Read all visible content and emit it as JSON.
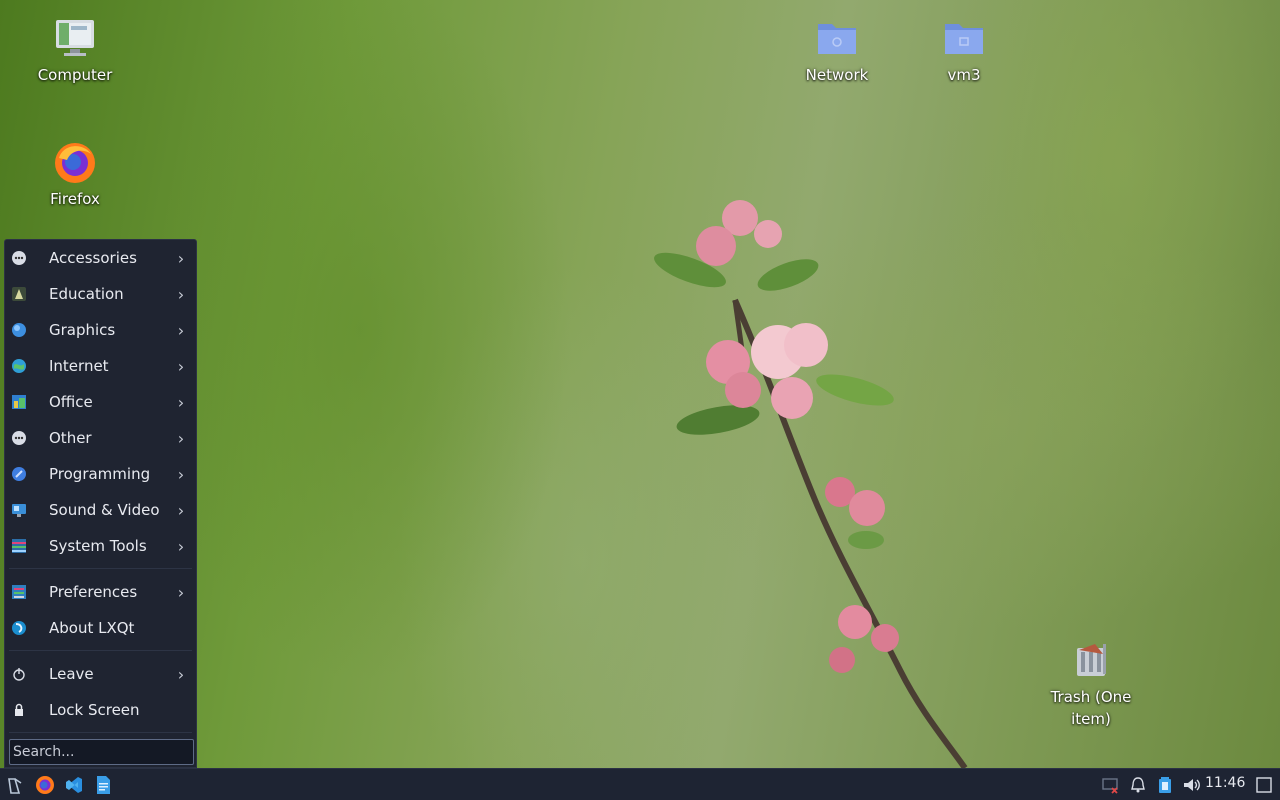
{
  "desktop": {
    "icons": [
      {
        "label": "Computer",
        "icon": "computer-icon"
      },
      {
        "label": "Firefox",
        "icon": "firefox-icon"
      },
      {
        "label": "Network",
        "icon": "network-folder-icon"
      },
      {
        "label": "vm3",
        "icon": "vm3-folder-icon"
      },
      {
        "label": "Trash (One item)",
        "icon": "trash-icon"
      }
    ]
  },
  "start_menu": {
    "items": [
      {
        "label": "Accessories",
        "icon": "accessories-icon",
        "submenu": true
      },
      {
        "label": "Education",
        "icon": "education-icon",
        "submenu": true
      },
      {
        "label": "Graphics",
        "icon": "graphics-icon",
        "submenu": true
      },
      {
        "label": "Internet",
        "icon": "internet-icon",
        "submenu": true
      },
      {
        "label": "Office",
        "icon": "office-icon",
        "submenu": true
      },
      {
        "label": "Other",
        "icon": "other-icon",
        "submenu": true
      },
      {
        "label": "Programming",
        "icon": "programming-icon",
        "submenu": true
      },
      {
        "label": "Sound & Video",
        "icon": "sound-video-icon",
        "submenu": true
      },
      {
        "label": "System Tools",
        "icon": "system-tools-icon",
        "submenu": true
      },
      {
        "label": "Preferences",
        "icon": "preferences-icon",
        "submenu": true
      },
      {
        "label": "About LXQt",
        "icon": "lxqt-icon",
        "submenu": false
      },
      {
        "label": "Leave",
        "icon": "power-icon",
        "submenu": true
      },
      {
        "label": "Lock Screen",
        "icon": "lock-icon",
        "submenu": false
      }
    ],
    "search_placeholder": "Search..."
  },
  "taskbar": {
    "launchers": [
      "start-menu-icon",
      "firefox-icon",
      "vscode-icon",
      "text-editor-icon"
    ],
    "tray": [
      "network-disconnected-icon",
      "notification-bell-icon",
      "battery-icon",
      "volume-icon",
      "show-desktop-icon"
    ],
    "clock": "11:46"
  },
  "colors": {
    "panel_bg": "#1e2433",
    "menu_bg": "#1f2431",
    "folder_blue": "#7f9fe6",
    "firefox_orange": "#ff7a1a"
  }
}
